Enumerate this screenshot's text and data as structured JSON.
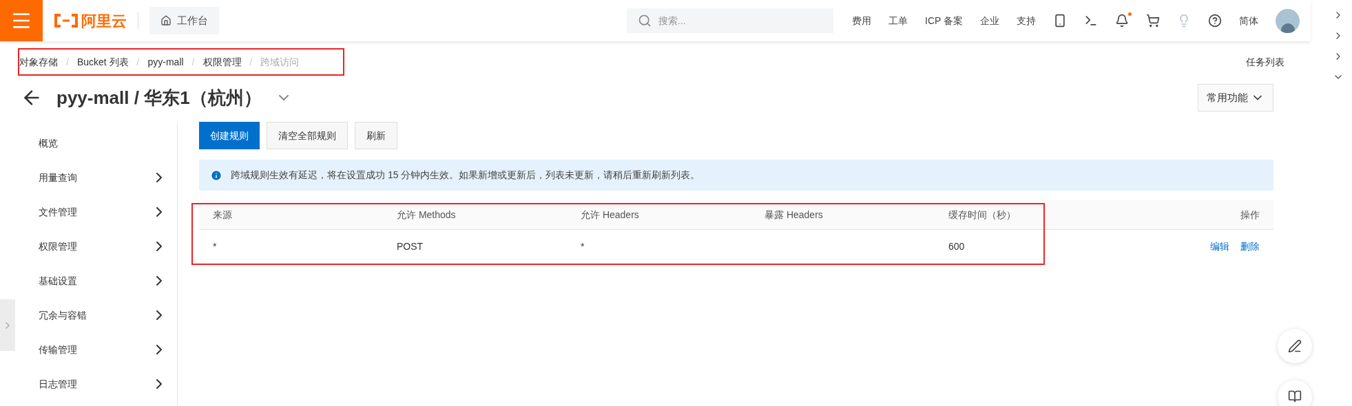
{
  "topbar": {
    "logo": "阿里云",
    "workbench": "工作台",
    "search": {
      "placeholder": "搜索..."
    },
    "nav": [
      "费用",
      "工单",
      "ICP 备案",
      "企业",
      "支持"
    ],
    "icons": [
      {
        "kind": "app"
      },
      {
        "kind": "terminal"
      },
      {
        "kind": "bell",
        "badge": true
      },
      {
        "kind": "cart"
      },
      {
        "kind": "bulb"
      },
      {
        "kind": "help"
      }
    ],
    "language": "简体"
  },
  "breadcrumb_separator": "/",
  "breadcrumb": [
    {
      "label": "对象存储",
      "current": false
    },
    {
      "label": "Bucket 列表",
      "current": false
    },
    {
      "label": "pyy-mall",
      "current": false
    },
    {
      "label": "权限管理",
      "current": false
    },
    {
      "label": "跨域访问",
      "current": true
    }
  ],
  "task_list": "任务列表",
  "title": "pyy-mall / 华东1（杭州）",
  "common_functions": "常用功能",
  "sidebar": {
    "items": [
      {
        "label": "概览",
        "expandable": false
      },
      {
        "label": "用量查询",
        "expandable": true
      },
      {
        "label": "文件管理",
        "expandable": true
      },
      {
        "label": "权限管理",
        "expandable": true
      },
      {
        "label": "基础设置",
        "expandable": true
      },
      {
        "label": "冗余与容错",
        "expandable": true
      },
      {
        "label": "传输管理",
        "expandable": true
      },
      {
        "label": "日志管理",
        "expandable": true
      }
    ]
  },
  "buttons": [
    {
      "label": "创建规则",
      "primary": true
    },
    {
      "label": "清空全部规则",
      "primary": false
    },
    {
      "label": "刷新",
      "primary": false
    }
  ],
  "notice": "跨域规则生效有延迟，将在设置成功 15 分钟内生效。如果新增或更新后，列表未更新，请稍后重新刷新列表。",
  "table": {
    "columns": [
      "来源",
      "允许 Methods",
      "允许 Headers",
      "暴露 Headers",
      "缓存时间（秒）",
      "操作"
    ],
    "rows": [
      {
        "cells": [
          "*",
          "POST",
          "*",
          "",
          "600"
        ],
        "actions": [
          "编辑",
          "删除"
        ]
      }
    ]
  }
}
